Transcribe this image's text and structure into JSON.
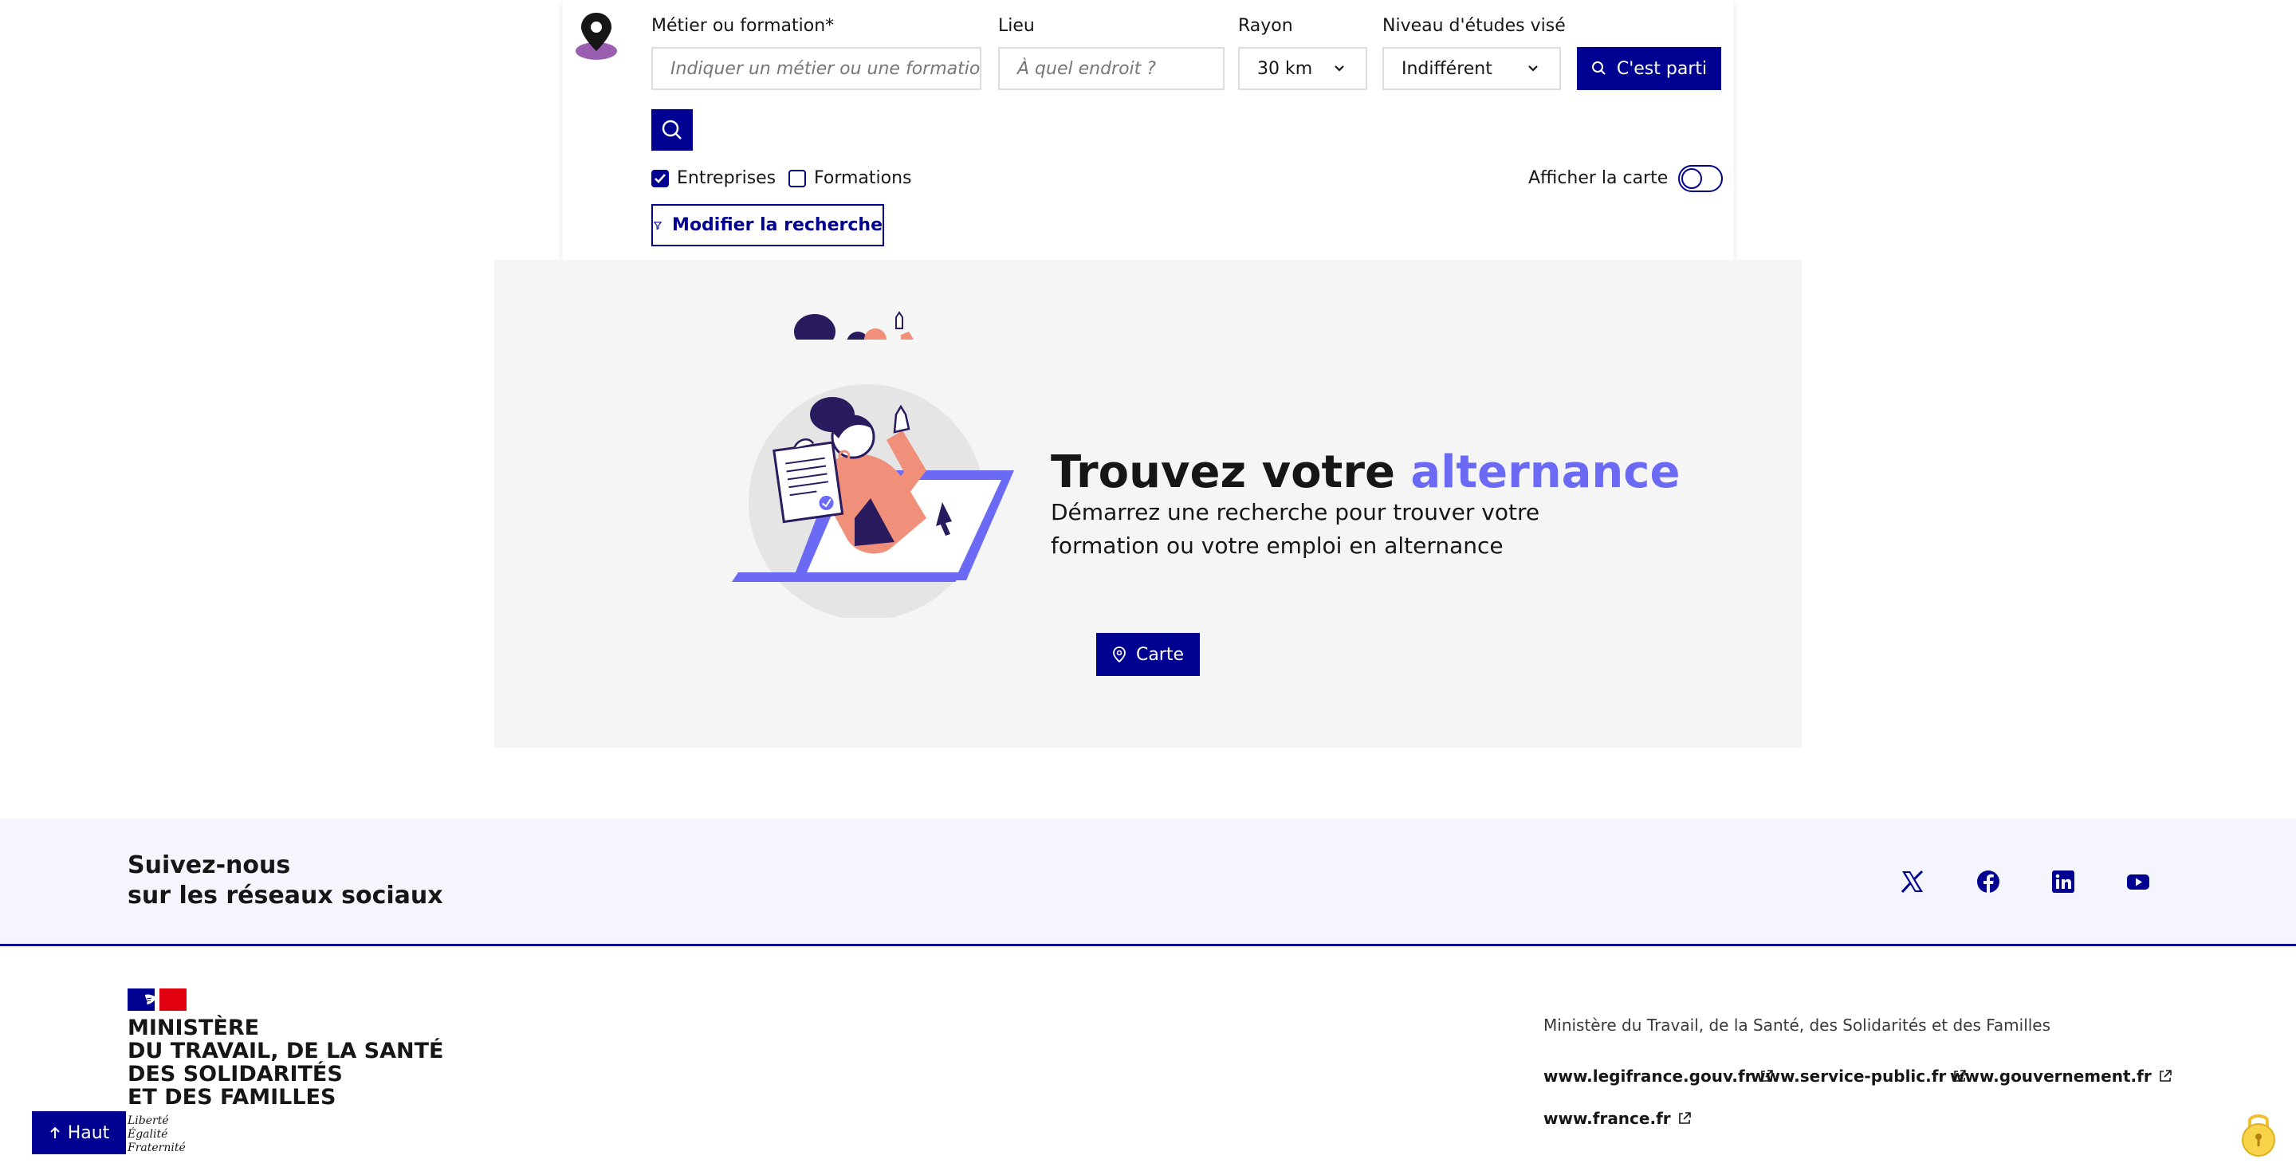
{
  "search": {
    "metier_label": "Métier ou formation",
    "metier_required": "*",
    "metier_placeholder": "Indiquer un métier ou une formation",
    "lieu_label": "Lieu",
    "lieu_placeholder": "À quel endroit ?",
    "rayon_label": "Rayon",
    "rayon_value": "30 km",
    "niveau_label": "Niveau d'études visé",
    "niveau_value": "Indifférent",
    "submit_label": "C'est parti",
    "filter_entreprises": "Entreprises",
    "filter_entreprises_checked": true,
    "filter_formations": "Formations",
    "filter_formations_checked": false,
    "map_toggle_label": "Afficher la carte",
    "map_toggle_on": false,
    "modify_label": "Modifier la recherche"
  },
  "hero": {
    "title_part1": "Trouvez votre ",
    "title_accent": "alternance",
    "description": "Démarrez une recherche pour trouver votre formation ou votre emploi en alternance",
    "map_button": "Carte"
  },
  "social": {
    "title_line1": "Suivez-nous",
    "title_line2": "sur les réseaux sociaux",
    "networks": [
      "x-icon",
      "facebook-icon",
      "linkedin-icon",
      "youtube-icon"
    ]
  },
  "footer": {
    "ministry_lines": [
      "MINISTÈRE",
      "DU TRAVAIL, DE LA SANTÉ",
      "DES SOLIDARITÉS",
      "ET DES FAMILLES"
    ],
    "motto": [
      "Liberté",
      "Égalité",
      "Fraternité"
    ],
    "description": "Ministère du Travail, de la Santé, des Solidarités et des Familles",
    "links": [
      "www.legifrance.gouv.fr",
      "www.service-public.fr",
      "www.gouvernement.fr",
      "www.france.fr"
    ]
  },
  "top_button": "Haut",
  "colors": {
    "primary": "#000091",
    "accent": "#6a6af4",
    "illustration_coral": "#f0907a",
    "illustration_dark": "#2a1a5e",
    "background_gray": "#f5f5f5",
    "social_bg": "#f5f5fe"
  }
}
